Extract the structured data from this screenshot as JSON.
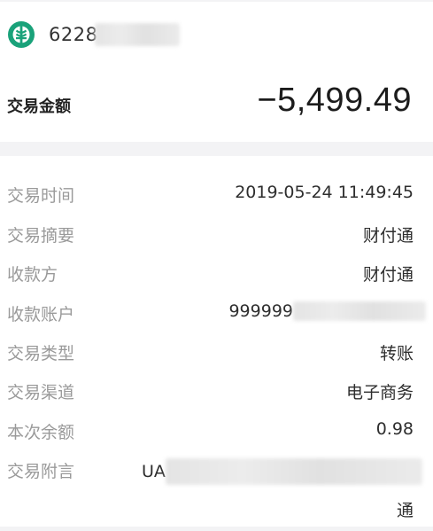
{
  "account": {
    "number_prefix": "6228",
    "bank_icon": "abc-bank-logo-icon",
    "brand_color": "#1aa27a"
  },
  "amount": {
    "label": "交易金额",
    "value": "−5,499.49"
  },
  "details": [
    {
      "label": "交易时间",
      "value": "2019-05-24 11:49:45"
    },
    {
      "label": "交易摘要",
      "value": "财付通"
    },
    {
      "label": "收款方",
      "value": "财付通"
    },
    {
      "label": "收款账户",
      "value": "999999"
    },
    {
      "label": "交易类型",
      "value": "转账"
    },
    {
      "label": "交易渠道",
      "value": "电子商务"
    },
    {
      "label": "本次余额",
      "value": "0.98"
    },
    {
      "label": "交易附言",
      "value": "UA",
      "value_line2": "通"
    }
  ]
}
